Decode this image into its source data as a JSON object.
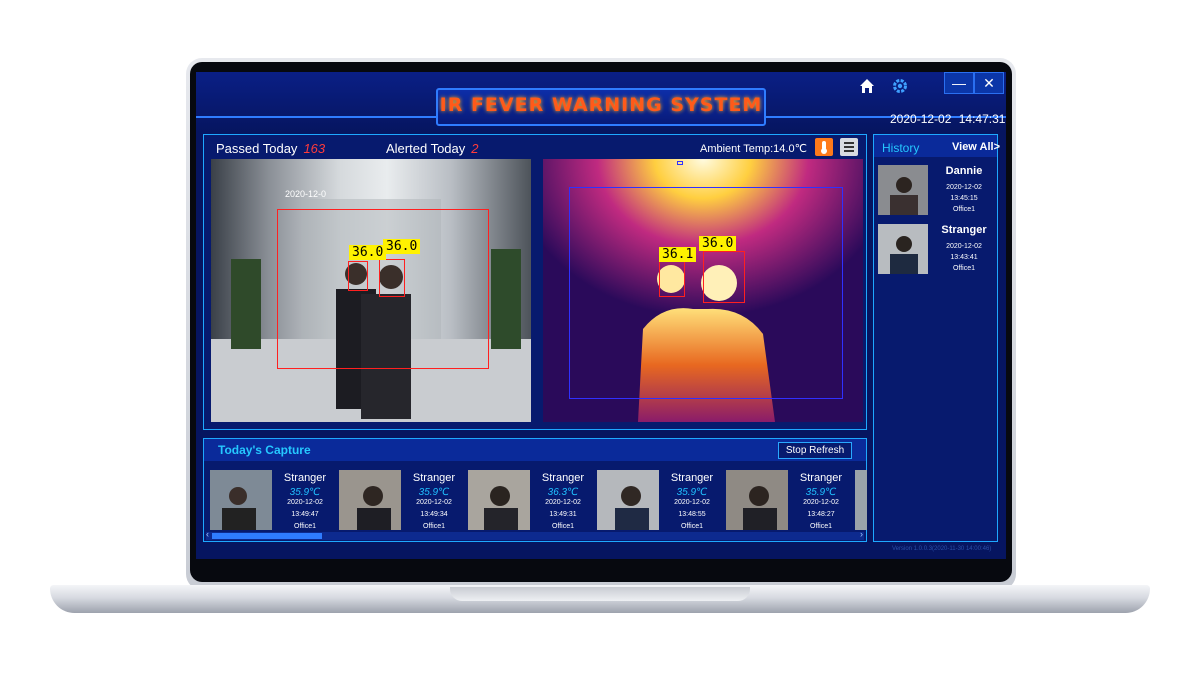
{
  "app": {
    "title": "IR FEVER WARNING SYSTEM",
    "date": "2020-12-02",
    "time": "14:47:31",
    "version": "Version 1.0.0.3(2020-11-30 14:00:46)"
  },
  "window": {
    "minimize": "—",
    "close": "✕"
  },
  "stats": {
    "passed_label": "Passed Today",
    "passed_value": "163",
    "alerted_label": "Alerted Today",
    "alerted_value": "2",
    "ambient": "Ambient Temp:14.0℃"
  },
  "cameras": {
    "rgb_timestamp": "2020-12-0",
    "rgb_tags": [
      "36.0",
      "36.0"
    ],
    "ir_tags": [
      "36.1",
      "36.0"
    ]
  },
  "capture": {
    "title": "Today's Capture",
    "stop_label": "Stop Refresh",
    "items": [
      {
        "name": "Stranger",
        "temp": "35.9℃",
        "date": "2020-12-02",
        "time": "13:49:47",
        "location": "Office1"
      },
      {
        "name": "Stranger",
        "temp": "35.9℃",
        "date": "2020-12-02",
        "time": "13:49:34",
        "location": "Office1"
      },
      {
        "name": "Stranger",
        "temp": "36.3℃",
        "date": "2020-12-02",
        "time": "13:49:31",
        "location": "Office1"
      },
      {
        "name": "Stranger",
        "temp": "35.9℃",
        "date": "2020-12-02",
        "time": "13:48:55",
        "location": "Office1"
      },
      {
        "name": "Stranger",
        "temp": "35.9℃",
        "date": "2020-12-02",
        "time": "13:48:27",
        "location": "Office1"
      }
    ],
    "scroll_left": "‹",
    "scroll_right": "›"
  },
  "history": {
    "title": "History",
    "view_all": "View All>",
    "items": [
      {
        "name": "Dannie",
        "date": "2020-12-02",
        "time": "13:45:15",
        "location": "Office1"
      },
      {
        "name": "Stranger",
        "date": "2020-12-02",
        "time": "13:43:41",
        "location": "Office1"
      }
    ]
  },
  "colors": {
    "background": "#061560",
    "accent": "#1ea8ff",
    "title_text": "#ff5a1a",
    "alert": "#ff3b3b",
    "temp_tag": "#fff200",
    "temp_text": "#20c0ff"
  },
  "icons": [
    "home-icon",
    "gear-icon",
    "thermometer-icon",
    "list-icon"
  ]
}
